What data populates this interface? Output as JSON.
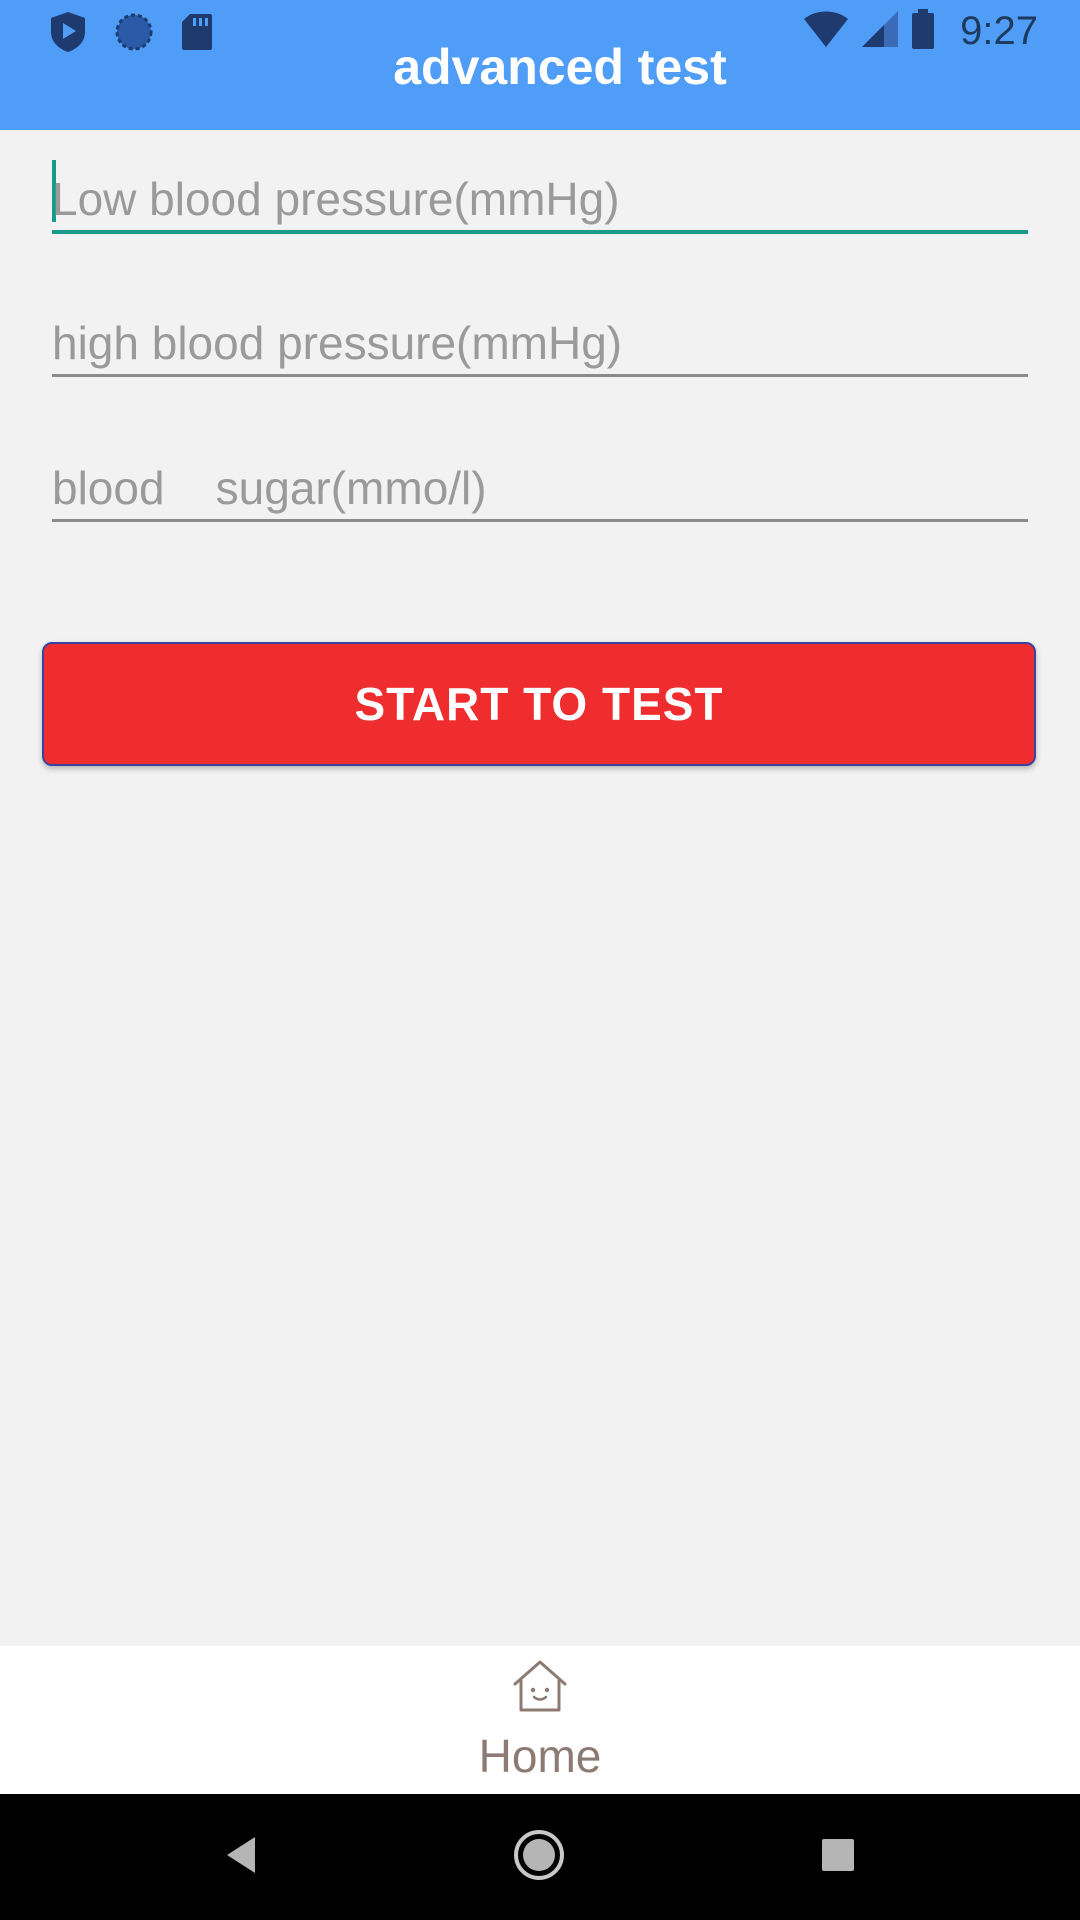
{
  "status_bar": {
    "time": "9:27",
    "left_icons": [
      "shield-play-icon",
      "sync-circle-icon",
      "sd-card-icon"
    ],
    "right_icons": [
      "wifi-icon",
      "signal-icon",
      "battery-icon"
    ]
  },
  "app_bar": {
    "title": "advanced test",
    "background": "#4f9df7"
  },
  "form": {
    "low_bp": {
      "placeholder": "Low blood pressure(mmHg)",
      "value": ""
    },
    "high_bp": {
      "placeholder": "high blood pressure(mmHg)",
      "value": ""
    },
    "blood_sugar": {
      "placeholder": "blood    sugar(mmo/l)",
      "value": ""
    }
  },
  "start_button": {
    "label": "START TO TEST",
    "color": "#ef2d2e"
  },
  "bottom_nav": {
    "home_label": "Home",
    "home_icon": "house-smile-icon"
  },
  "system_nav": {
    "buttons": [
      "back-icon",
      "home-circle-icon",
      "recents-square-icon"
    ]
  }
}
